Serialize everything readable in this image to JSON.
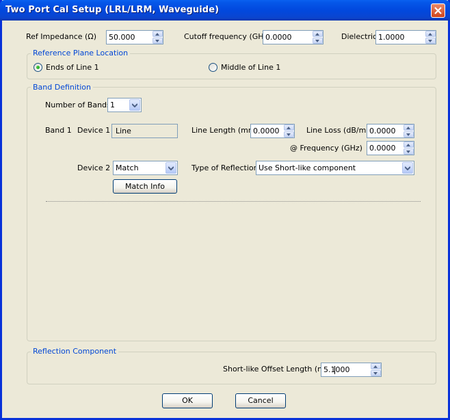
{
  "window": {
    "title": "Two Port Cal Setup (LRL/LRM, Waveguide)"
  },
  "top": {
    "ref_impedance_label": "Ref Impedance (Ω)",
    "ref_impedance_value": "50.000",
    "cutoff_label": "Cutoff frequency (GHz)",
    "cutoff_value": "0.0000",
    "dielectric_label": "Dielectric",
    "dielectric_value": "1.0000"
  },
  "reference_plane": {
    "legend": "Reference Plane Location",
    "options": [
      {
        "label": "Ends of Line 1",
        "selected": true
      },
      {
        "label": "Middle of Line 1",
        "selected": false
      }
    ]
  },
  "band_definition": {
    "legend": "Band Definition",
    "num_bands_label": "Number of Bands",
    "num_bands_value": "1",
    "band_label": "Band 1",
    "device1_label": "Device 1",
    "device1_value": "Line",
    "line_length_label": "Line Length (mm)",
    "line_length_value": "0.0000",
    "line_loss_label": "Line Loss (dB/mm)",
    "line_loss_value": "0.0000",
    "frequency_label": "@ Frequency (GHz)",
    "frequency_value": "0.0000",
    "device2_label": "Device 2",
    "device2_value": "Match",
    "reflection_type_label": "Type of Reflection",
    "reflection_type_value": "Use Short-like component",
    "match_info_label": "Match Info"
  },
  "reflection_component": {
    "legend": "Reflection Component",
    "offset_label": "Short-like Offset Length (mm)",
    "offset_value": "5.1000"
  },
  "buttons": {
    "ok": "OK",
    "cancel": "Cancel"
  },
  "colors": {
    "titlebar": "#0148de",
    "legend_text": "#0046d5",
    "dialog_bg": "#ece9d8"
  }
}
